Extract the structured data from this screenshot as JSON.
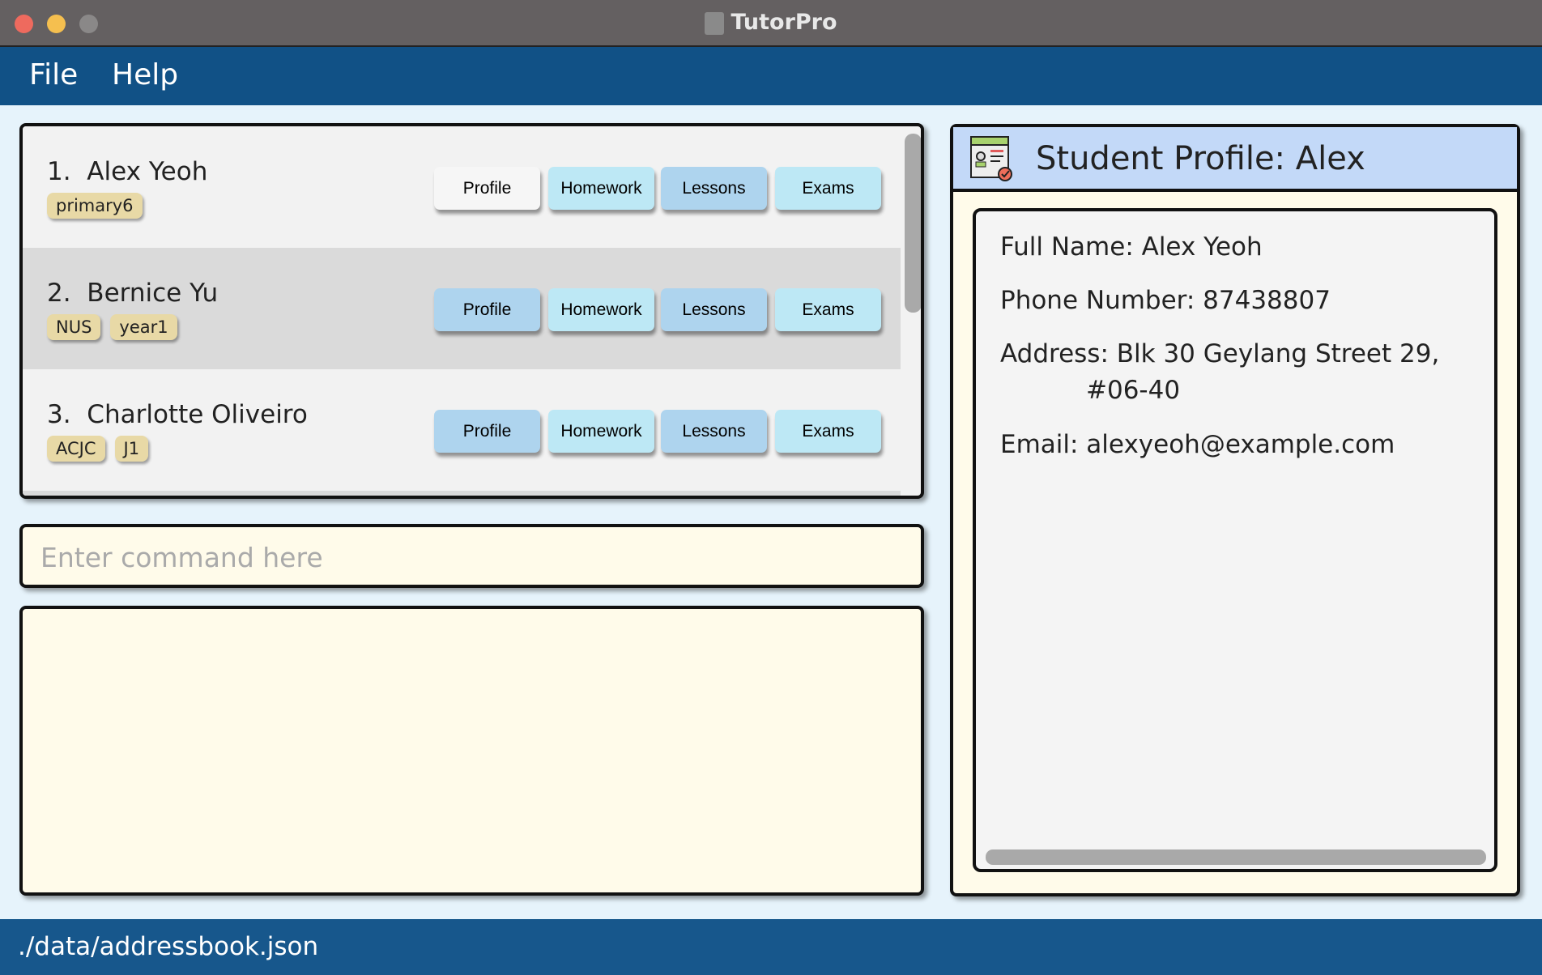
{
  "window": {
    "title": "TutorPro"
  },
  "menu": {
    "items": [
      "File",
      "Help"
    ]
  },
  "students": [
    {
      "index": "1.",
      "name": "Alex Yeoh",
      "tags": [
        "primary6"
      ],
      "selected_button": "Profile"
    },
    {
      "index": "2.",
      "name": "Bernice Yu",
      "tags": [
        "NUS",
        "year1"
      ]
    },
    {
      "index": "3.",
      "name": "Charlotte Oliveiro",
      "tags": [
        "ACJC",
        "J1"
      ]
    }
  ],
  "buttons": {
    "profile": "Profile",
    "homework": "Homework",
    "lessons": "Lessons",
    "exams": "Exams"
  },
  "command": {
    "placeholder": "Enter command here",
    "value": ""
  },
  "result": {
    "text": ""
  },
  "profile": {
    "title": "Student Profile: Alex",
    "full_name": "Full Name: Alex Yeoh",
    "phone": "Phone Number: 87438807",
    "address_line1": "Address: Blk 30 Geylang Street 29,",
    "address_line2": "#06-40",
    "email": "Email: alexyeoh@example.com"
  },
  "status": {
    "path": "./data/addressbook.json"
  },
  "colors": {
    "menubar": "#115186",
    "profile_btn": "#aed4ee",
    "homework_btn": "#bde8f5",
    "lessons_btn": "#aed4ee",
    "exams_btn": "#bde8f5",
    "tag": "#e8d9a6"
  }
}
